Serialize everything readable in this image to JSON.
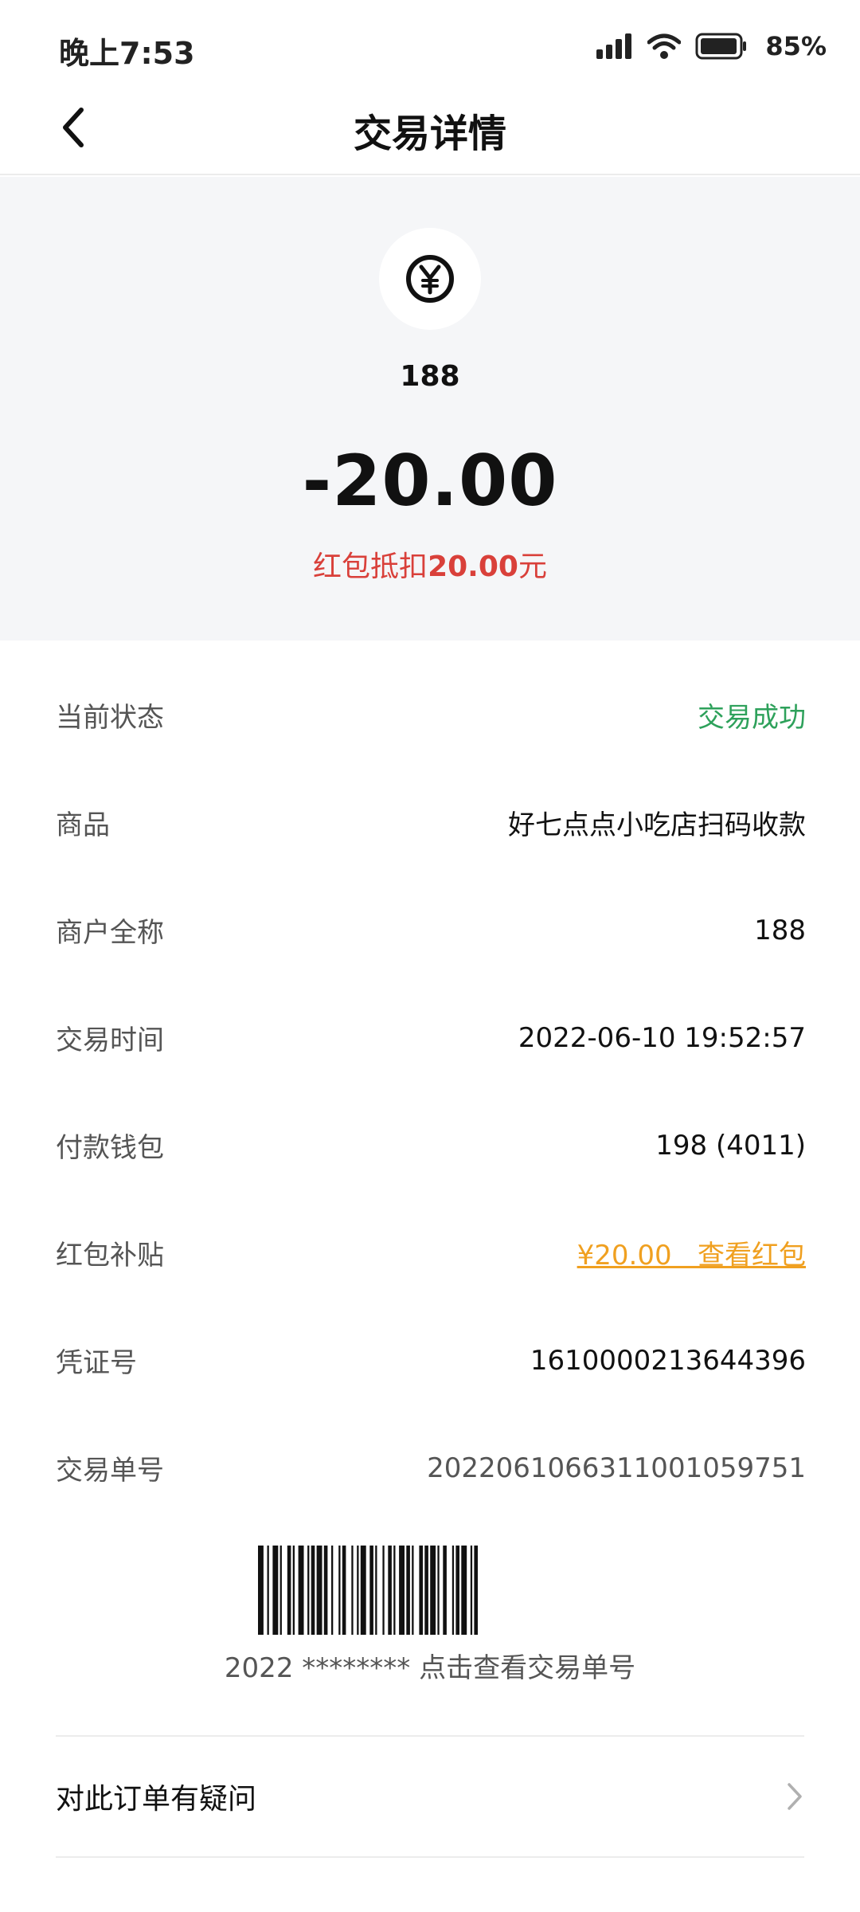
{
  "status_bar": {
    "time": "晚上7:53",
    "battery": "85%",
    "icons": [
      "signal-icon",
      "wifi-icon",
      "battery-icon"
    ]
  },
  "header": {
    "title": "交易详情",
    "back_icon": "chevron-left-icon"
  },
  "summary": {
    "icon": "yuan-coin-icon",
    "merchant": "188",
    "amount": "-20.00",
    "discount_prefix": "红包抵扣",
    "discount_value": "20.00",
    "discount_suffix": "元"
  },
  "details": [
    {
      "label": "当前状态",
      "value": "交易成功"
    },
    {
      "label": "商品",
      "value": "好七点点小吃店扫码收款"
    },
    {
      "label": "商户全称",
      "value": "188"
    },
    {
      "label": "交易时间",
      "value": "2022-06-10 19:52:57"
    },
    {
      "label": "付款钱包",
      "value": "198 (4011)"
    },
    {
      "label": "红包补贴",
      "value": "¥20.00   查看红包"
    },
    {
      "label": "凭证号",
      "value": "1610000213644396"
    },
    {
      "label": "交易单号",
      "value": "2022061066311001059751"
    }
  ],
  "barcode": {
    "caption": "2022 ******** 点击查看交易单号"
  },
  "question": {
    "label": "对此订单有疑问",
    "icon": "chevron-right-icon"
  },
  "colors": {
    "success": "#2ea15b",
    "discount_red": "#d9403a",
    "link_orange": "#f0a020",
    "hero_bg": "#f5f6f8"
  }
}
